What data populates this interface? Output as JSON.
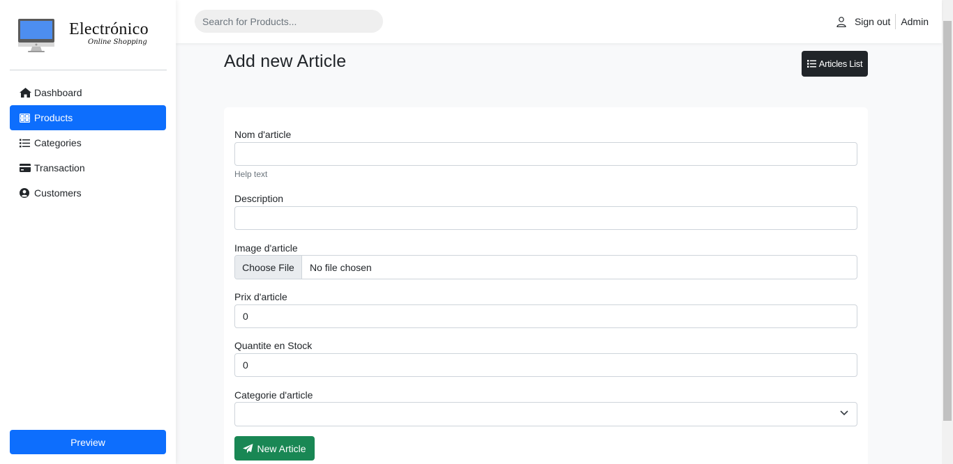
{
  "brand": {
    "name": "Electrónico",
    "tagline": "Online Shopping"
  },
  "sidebar": {
    "items": [
      {
        "label": "Dashboard",
        "icon": "home-icon",
        "active": false
      },
      {
        "label": "Products",
        "icon": "grid-icon",
        "active": true
      },
      {
        "label": "Categories",
        "icon": "list-icon",
        "active": false
      },
      {
        "label": "Transaction",
        "icon": "credit-card-icon",
        "active": false
      },
      {
        "label": "Customers",
        "icon": "user-circle-icon",
        "active": false
      }
    ],
    "preview_label": "Preview"
  },
  "topbar": {
    "search_placeholder": "Search for Products...",
    "signout_label": "Sign out",
    "user_name": "Admin"
  },
  "main": {
    "title": "Add new Article",
    "list_button_label": "Articles List"
  },
  "form": {
    "name_label": "Nom d'article",
    "name_value": "",
    "name_help": "Help text",
    "description_label": "Description",
    "description_value": "",
    "image_label": "Image d'article",
    "choose_file_label": "Choose File",
    "no_file_text": "No file chosen",
    "price_label": "Prix d'article",
    "price_value": "0",
    "stock_label": "Quantite en Stock",
    "stock_value": "0",
    "category_label": "Categorie d'article",
    "category_value": "",
    "submit_label": "New Article"
  },
  "colors": {
    "primary": "#0d6efd",
    "dark": "#212529",
    "success": "#198754",
    "background": "#f8f9fa"
  }
}
